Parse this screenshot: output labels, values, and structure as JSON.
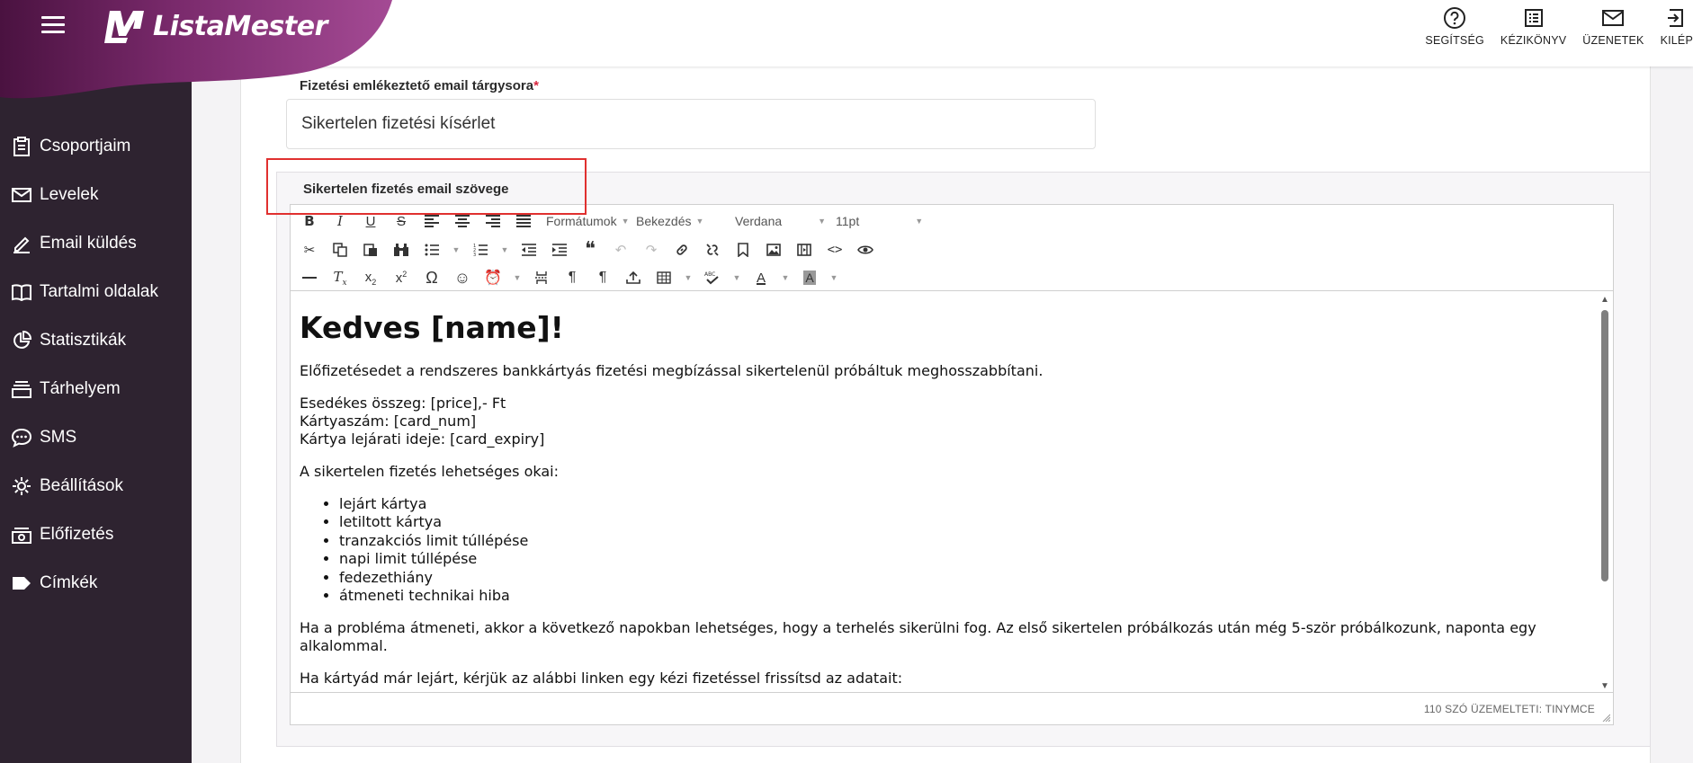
{
  "app": {
    "brand": "ListaMester"
  },
  "topbar": {
    "actions": [
      {
        "label": "SEGÍTSÉG",
        "icon": "help-circle-icon"
      },
      {
        "label": "KÉZIKÖNYV",
        "icon": "manual-list-icon"
      },
      {
        "label": "ÜZENETEK",
        "icon": "mail-icon"
      },
      {
        "label": "KILÉP",
        "icon": "logout-icon"
      }
    ]
  },
  "sidebar": {
    "items": [
      {
        "label": "Csoportjaim",
        "icon": "clipboard-icon"
      },
      {
        "label": "Levelek",
        "icon": "envelope-icon"
      },
      {
        "label": "Email küldés",
        "icon": "pen-icon"
      },
      {
        "label": "Tartalmi oldalak",
        "icon": "book-icon"
      },
      {
        "label": "Statisztikák",
        "icon": "pie-chart-icon"
      },
      {
        "label": "Tárhelyem",
        "icon": "storage-icon"
      },
      {
        "label": "SMS",
        "icon": "chat-bubble-icon"
      },
      {
        "label": "Beállítások",
        "icon": "gear-icon"
      },
      {
        "label": "Előfizetés",
        "icon": "subscription-icon"
      },
      {
        "label": "Címkék",
        "icon": "tag-icon"
      }
    ]
  },
  "form": {
    "subject_label": "Fizetési emlékeztető email tárgysora",
    "required_mark": "*",
    "subject_value": "Sikertelen fizetési kísérlet",
    "editor_label": "Sikertelen fizetés email szövege"
  },
  "editor": {
    "selects": {
      "formats": "Formátumok",
      "block": "Bekezdés",
      "font": "Verdana",
      "size": "11pt"
    },
    "content": {
      "heading": "Kedves [name]!",
      "p1": "Előfizetésedet a rendszeres bankkártyás fizetési megbízással sikertelenül próbáltuk meghosszabbítani.",
      "amount_line": "Esedékes összeg: [price],- Ft",
      "card_line": "Kártyaszám: [card_num]",
      "expiry_line": "Kártya lejárati ideje: [card_expiry]",
      "reasons_intro": "A sikertelen fizetés lehetséges okai:",
      "reasons": [
        "lejárt kártya",
        "letiltott kártya",
        "tranzakciós limit túllépése",
        "napi limit túllépése",
        "fedezethiány",
        "átmeneti technikai hiba"
      ],
      "p_temp": "Ha a probléma átmeneti, akkor a következő napokban lehetséges, hogy a terhelés sikerülni fog. Az első sikertelen próbálkozás után még 5-ször próbálkozunk, naponta egy alkalommal.",
      "p_expired": "Ha kártyád már lejárt, kérjük az alábbi linken egy kézi fizetéssel frissítsd az adatait:"
    },
    "status": "110 SZÓ ÜZEMELTETI: TINYMCE"
  },
  "colors": {
    "sidebar_bg": "#2e2330",
    "brand_gradient_start": "#6a1a5e",
    "brand_gradient_end": "#a44a94",
    "highlight": "#e0302f",
    "required": "#d8253d"
  }
}
